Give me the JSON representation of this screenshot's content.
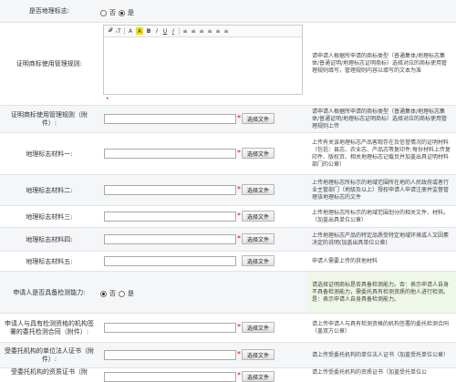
{
  "rows": {
    "geo_mark": {
      "label": "是否地理标志:",
      "options": [
        "否",
        "是"
      ],
      "selected": "是"
    },
    "rules_editor": {
      "label": "证明商标使用管理规则:",
      "toolbar": [
        "𝓕",
        "ₜT",
        "A",
        "A",
        "B",
        "I",
        "U",
        "I",
        "≡",
        "≡",
        "≡",
        "≡",
        "≡",
        "≡"
      ],
      "hint": "请申请人根据所申请的商标类型（普通集体/地理标志集体/普通证明/地理标志证明商标）选择对应的商标使用管理规则填写，管理规则内容以填写的文本为准",
      "required_dot": "•"
    },
    "rules_attach": {
      "label": "证明商标使用管理规则（附件）:",
      "button": "选择文件",
      "hint": "请申请人根据所申请的商标类型（普通集体/地理标志集体/普通证明/地理标志证明商标）选择对应的商标使用管理规则上传"
    },
    "material1": {
      "label": "地理标志材料一:",
      "button": "选择文件",
      "hint": "上传有关该地理标志产品客观存在及信誉情况的证明材料（包括：县志、农业志、产品志等复印件;每份材料上传复印件、版权页、相关地理标志记载页并加盖出具证明材料部门的公章）"
    },
    "material2": {
      "label": "地理标志材料二:",
      "button": "选择文件",
      "hint": "上传地理标志所标示的地域范围所在地的人民政府或者行业主管部门（地级及以上）授权申请人申请注册并监督管理该地理标志的文件"
    },
    "material3": {
      "label": "地理标志材料三:",
      "button": "选择文件",
      "hint": "上传地理标志所标示的地域范围划分的相关文件、材料。（加盖出具单位公章）"
    },
    "material4": {
      "label": "地理标志材料四:",
      "button": "选择文件",
      "hint": "上传地理标志产品的特定品质受特定地域环境或人文因素决定的说明(加盖出具单位公章)"
    },
    "material5": {
      "label": "地理标志材料五:",
      "button": "选择文件",
      "hint": "申请人需要上传的其他材料"
    },
    "testing": {
      "label": "申请人是否具备检测能力:",
      "options": [
        "否",
        "是"
      ],
      "selected": "否",
      "hint": "请选择证明商标是否具备检测能力。否：表示申请人自身不具备检测能力，需委托具有检测资质的他人进行检测。\n是：表示申请人自身具备检测能力。"
    },
    "contract": {
      "label": "申请人与具有检测资格的机构签署的委托检测合同（附件）:",
      "button": "选择文件",
      "hint": "请上传申请人与具有检测资格的机构签署的委托检测合同（盖双方公章）"
    },
    "legal_cert": {
      "label": "受委托机构的单位法人证书（附件）:",
      "button": "选择文件",
      "hint": "请上传受委托机构的单位法人证书（加盖受托单位公章）"
    },
    "qualification": {
      "label": "受委托机构的资质证书（附",
      "button": "选择文件",
      "hint": "请上传受委托机构的资质证书（加盖受托单位公"
    }
  },
  "colors": {
    "required": "#ee0000",
    "hint_green": "#eef7e8",
    "row_alt": "#f4f6f8"
  }
}
